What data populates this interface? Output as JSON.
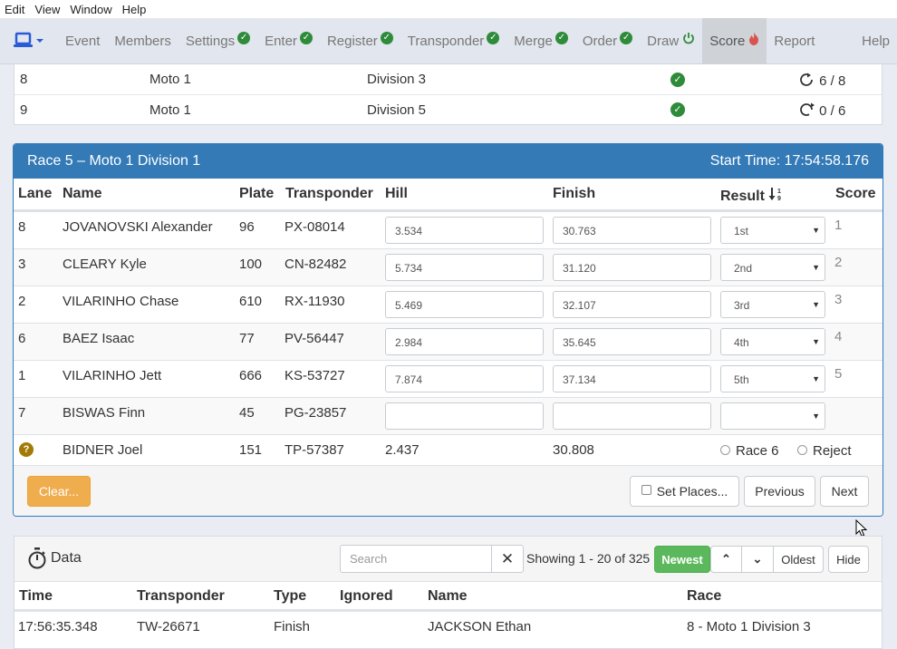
{
  "menubar": {
    "items": [
      "Edit",
      "View",
      "Window",
      "Help"
    ]
  },
  "nav": {
    "items": [
      {
        "label": "Event",
        "icon": ""
      },
      {
        "label": "Members",
        "icon": ""
      },
      {
        "label": "Settings",
        "icon": "check-circle-icon"
      },
      {
        "label": "Enter",
        "icon": "check-circle-icon"
      },
      {
        "label": "Register",
        "icon": "check-circle-icon"
      },
      {
        "label": "Transponder",
        "icon": "check-circle-icon"
      },
      {
        "label": "Merge",
        "icon": "check-circle-icon"
      },
      {
        "label": "Order",
        "icon": "check-circle-icon"
      },
      {
        "label": "Draw",
        "icon": "power-icon"
      },
      {
        "label": "Score",
        "icon": "fire-icon"
      },
      {
        "label": "Report",
        "icon": ""
      }
    ],
    "help": "Help",
    "active": "Score"
  },
  "heats": [
    {
      "num": "8",
      "moto": "Moto 1",
      "division": "Division 3",
      "progress": "6 / 8"
    },
    {
      "num": "9",
      "moto": "Moto 1",
      "division": "Division 5",
      "progress": "0 / 6"
    }
  ],
  "race": {
    "title": "Race 5 – Moto 1 Division 1",
    "start_time": "Start Time: 17:54:58.176",
    "columns": {
      "lane": "Lane",
      "name": "Name",
      "plate": "Plate",
      "transponder": "Transponder",
      "hill": "Hill",
      "finish": "Finish",
      "result": "Result",
      "score": "Score"
    },
    "rows": [
      {
        "lane": "8",
        "name": "JOVANOVSKI Alexander",
        "plate": "96",
        "transponder": "PX-08014",
        "hill": "3.534",
        "finish": "30.763",
        "result": "1st",
        "score": "1"
      },
      {
        "lane": "3",
        "name": "CLEARY Kyle",
        "plate": "100",
        "transponder": "CN-82482",
        "hill": "5.734",
        "finish": "31.120",
        "result": "2nd",
        "score": "2"
      },
      {
        "lane": "2",
        "name": "VILARINHO Chase",
        "plate": "610",
        "transponder": "RX-11930",
        "hill": "5.469",
        "finish": "32.107",
        "result": "3rd",
        "score": "3"
      },
      {
        "lane": "6",
        "name": "BAEZ Isaac",
        "plate": "77",
        "transponder": "PV-56447",
        "hill": "2.984",
        "finish": "35.645",
        "result": "4th",
        "score": "4"
      },
      {
        "lane": "1",
        "name": "VILARINHO Jett",
        "plate": "666",
        "transponder": "KS-53727",
        "hill": "7.874",
        "finish": "37.134",
        "result": "5th",
        "score": "5"
      },
      {
        "lane": "7",
        "name": "BISWAS Finn",
        "plate": "45",
        "transponder": "PG-23857",
        "hill": "",
        "finish": "",
        "result": "",
        "score": ""
      }
    ],
    "unknown": {
      "name": "BIDNER Joel",
      "plate": "151",
      "transponder": "TP-57387",
      "hill": "2.437",
      "finish": "30.808",
      "option1": "Race 6",
      "option2": "Reject"
    },
    "buttons": {
      "clear": "Clear...",
      "set_places": "Set Places...",
      "previous": "Previous",
      "next": "Next"
    }
  },
  "data": {
    "title": "Data",
    "search_placeholder": "Search",
    "showing": "Showing 1 - 20 of 325",
    "newest": "Newest",
    "oldest": "Oldest",
    "hide": "Hide",
    "columns": {
      "time": "Time",
      "transponder": "Transponder",
      "type": "Type",
      "ignored": "Ignored",
      "name": "Name",
      "race": "Race"
    },
    "rows": [
      {
        "time": "17:56:35.348",
        "transponder": "TW-26671",
        "type": "Finish",
        "ignored": "",
        "name": "JACKSON Ethan",
        "race": "8 - Moto 1 Division 3"
      }
    ]
  }
}
